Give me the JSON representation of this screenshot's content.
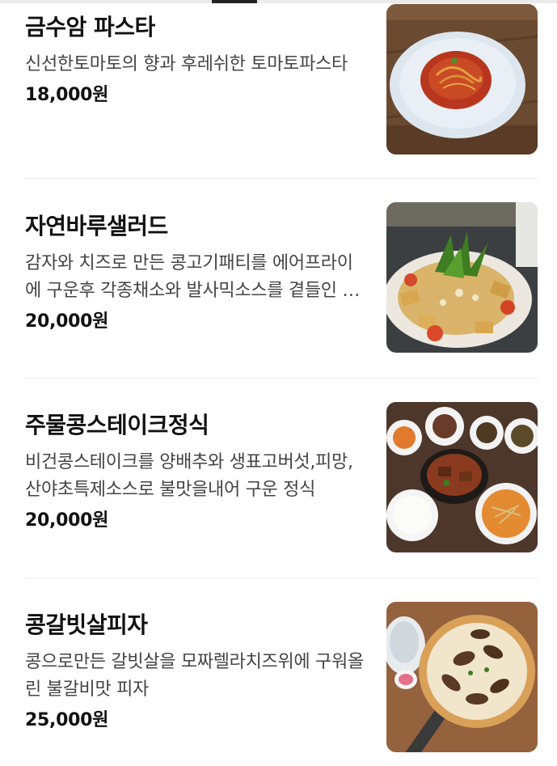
{
  "menu": {
    "items": [
      {
        "name": "금수암 파스타",
        "description": "신선한토마토의 향과 후레쉬한 토마토파스타",
        "price": "18,000원",
        "image_icon": "pasta-photo"
      },
      {
        "name": "자연바루샐러드",
        "description": "감자와 치즈로 만든 콩고기패티를 에어프라이에 구운후 각종채소와 발사믹소스를 곁들인 샐러드",
        "price": "20,000원",
        "image_icon": "salad-photo"
      },
      {
        "name": "주물콩스테이크정식",
        "description": "비건콩스테이크를 양배추와 생표고버섯,피망,산야초특제소스로 불맛을내어 구운 정식",
        "price": "20,000원",
        "image_icon": "steak-set-photo"
      },
      {
        "name": "콩갈빗살피자",
        "description": "콩으로만든 갈빗살을 모짜렐라치즈위에 구워올린 불갈비맛 피자",
        "price": "25,000원",
        "image_icon": "pizza-photo"
      }
    ]
  }
}
